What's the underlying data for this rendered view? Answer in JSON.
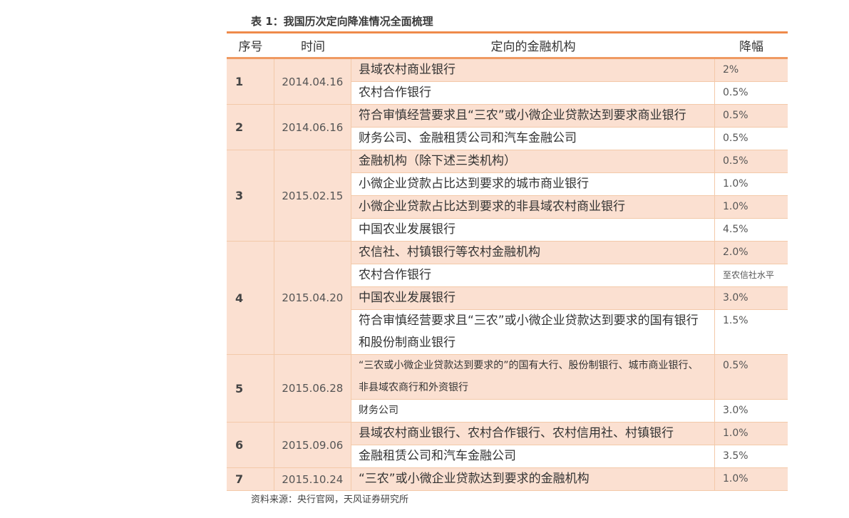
{
  "caption": "表 1：我国历次定向降准情况全面梳理",
  "headers": [
    "序号",
    "时间",
    "定向的金融机构",
    "降幅"
  ],
  "groups": [
    {
      "num": "1",
      "date": "2014.04.16",
      "rows": [
        {
          "inst": "县域农村商业银行",
          "amp": "2%"
        },
        {
          "inst": "农村合作银行",
          "amp": "0.5%"
        }
      ]
    },
    {
      "num": "2",
      "date": "2014.06.16",
      "rows": [
        {
          "inst": "符合审慎经营要求且“三农”或小微企业贷款达到要求商业银行",
          "amp": "0.5%"
        },
        {
          "inst": "财务公司、金融租赁公司和汽车金融公司",
          "amp": "0.5%"
        }
      ]
    },
    {
      "num": "3",
      "date": "2015.02.15",
      "rows": [
        {
          "inst": "金融机构（除下述三类机构）",
          "amp": "0.5%"
        },
        {
          "inst": "小微企业贷款占比达到要求的城市商业银行",
          "amp": "1.0%"
        },
        {
          "inst": "小微企业贷款占比达到要求的非县域农村商业银行",
          "amp": "1.0%"
        },
        {
          "inst": "中国农业发展银行",
          "amp": "4.5%"
        }
      ]
    },
    {
      "num": "4",
      "date": "2015.04.20",
      "rows": [
        {
          "inst": "农信社、村镇银行等农村金融机构",
          "amp": "2.0%"
        },
        {
          "inst": "农村合作银行",
          "amp": "至农信社水平"
        },
        {
          "inst": "中国农业发展银行",
          "amp": "3.0%"
        },
        {
          "inst": "符合审慎经营要求且“三农”或小微企业贷款达到要求的国有银行和股份制商业银行",
          "amp": "1.5%"
        }
      ]
    },
    {
      "num": "5",
      "date": "2015.06.28",
      "rows": [
        {
          "inst": "“三农或小微企业贷款达到要求的”的国有大行、股份制银行、城市商业银行、非县域农商行和外资银行",
          "amp": "0.5%"
        },
        {
          "inst": "财务公司",
          "amp": "3.0%"
        }
      ]
    },
    {
      "num": "6",
      "date": "2015.09.06",
      "rows": [
        {
          "inst": "县域农村商业银行、农村合作银行、农村信用社、村镇银行",
          "amp": "1.0%"
        },
        {
          "inst": "金融租赁公司和汽车金融公司",
          "amp": "3.5%"
        }
      ]
    },
    {
      "num": "7",
      "date": "2015.10.24",
      "rows": [
        {
          "inst": "“三农”或小微企业贷款达到要求的金融机构",
          "amp": "1.0%"
        }
      ]
    }
  ],
  "source": "资料来源：央行官网，天风证券研究所"
}
